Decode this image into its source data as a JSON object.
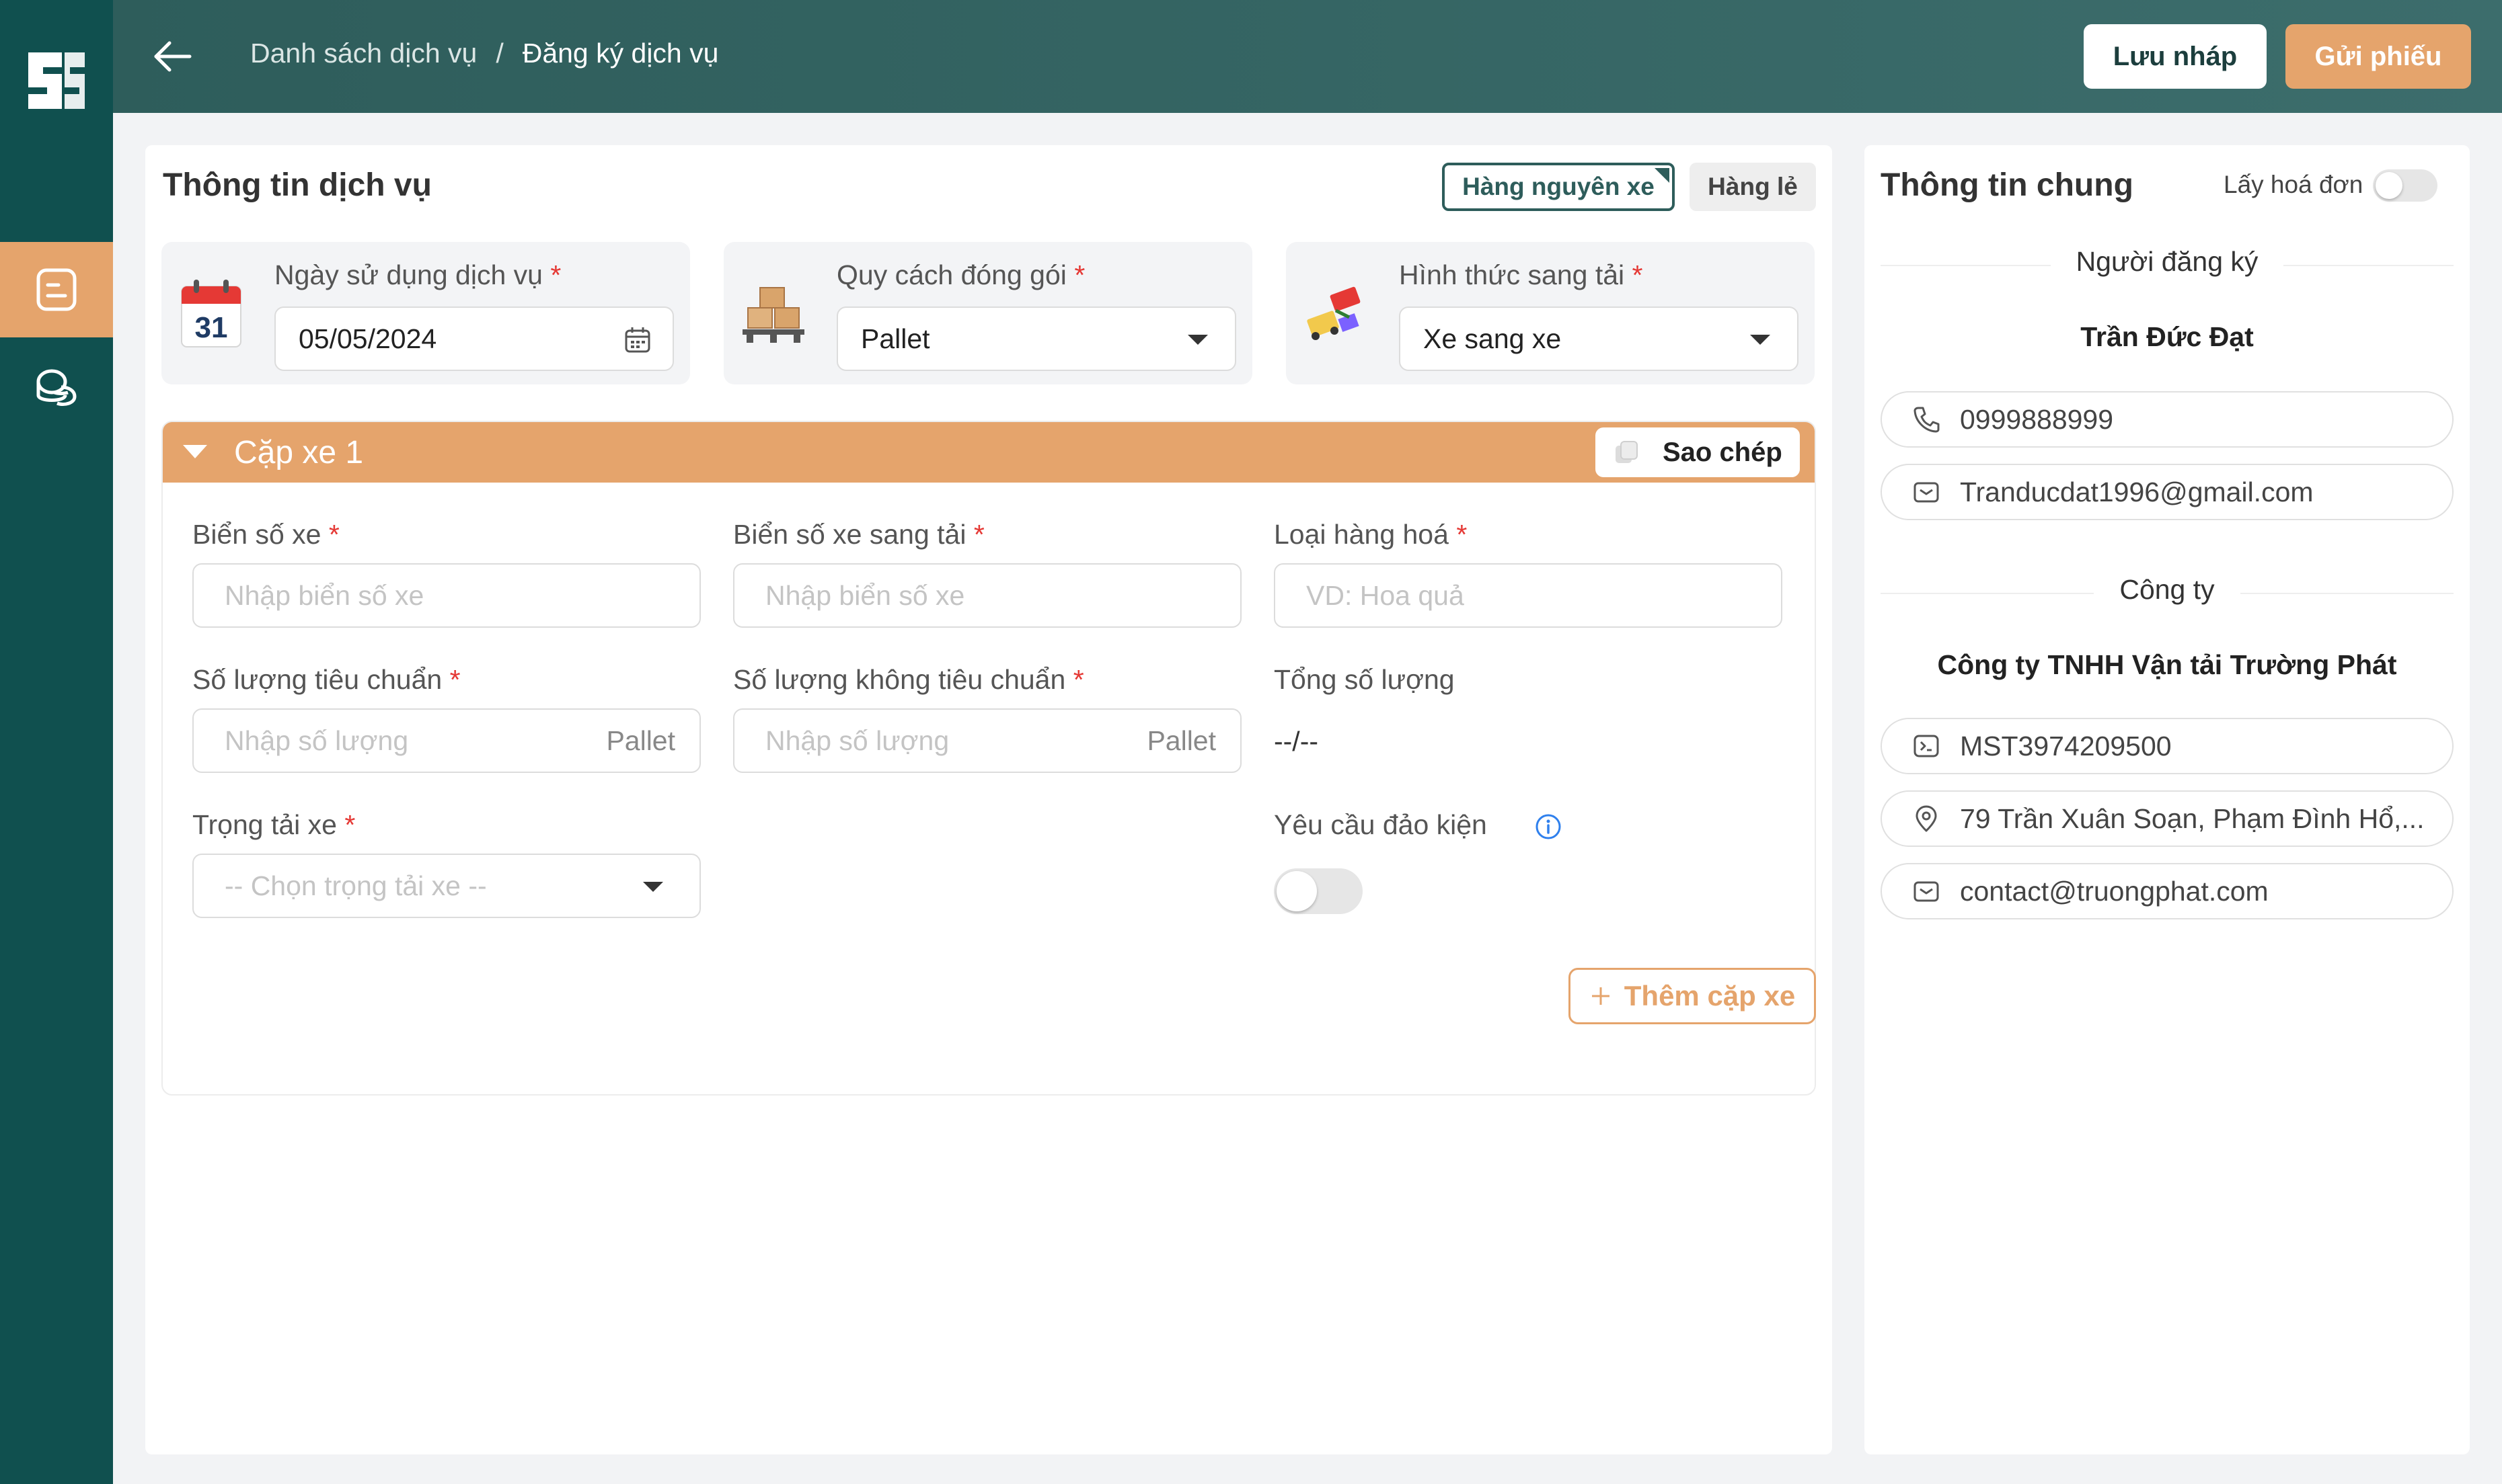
{
  "header": {
    "breadcrumb_parent": "Danh sách dịch vụ",
    "breadcrumb_separator": "/",
    "breadcrumb_current": "Đăng ký dịch vụ",
    "save_draft_label": "Lưu nháp",
    "submit_label": "Gửi phiếu"
  },
  "service": {
    "title": "Thông tin dịch vụ",
    "type_active": "Hàng nguyên xe",
    "type_inactive": "Hàng lẻ",
    "date_label": "Ngày sử dụng dịch vụ",
    "date_value": "05/05/2024",
    "date_icon_day": "31",
    "packing_label": "Quy cách đóng gói",
    "packing_value": "Pallet",
    "transfer_label": "Hình thức sang tải",
    "transfer_value": "Xe sang xe",
    "required_mark": "*"
  },
  "pair": {
    "title": "Cặp xe 1",
    "copy_label": "Sao chép",
    "plate_label": "Biển số xe",
    "plate_placeholder": "Nhập biển số xe",
    "transfer_plate_label": "Biển số xe sang tải",
    "transfer_plate_placeholder": "Nhập biển số xe",
    "goods_label": "Loại hàng hoá",
    "goods_placeholder": "VD: Hoa quả",
    "std_qty_label": "Số lượng tiêu chuẩn",
    "std_qty_placeholder": "Nhập số lượng",
    "std_qty_unit": "Pallet",
    "nonstd_qty_label": "Số lượng không tiêu chuẩn",
    "nonstd_qty_placeholder": "Nhập số lượng",
    "nonstd_qty_unit": "Pallet",
    "total_label": "Tổng số lượng",
    "total_value": "--/--",
    "load_label": "Trọng tải xe",
    "load_placeholder": "-- Chọn trọng tải xe --",
    "rearrange_label": "Yêu cầu đảo kiện",
    "rearrange_on": false
  },
  "add_pair_label": "Thêm cặp xe",
  "general": {
    "title": "Thông tin chung",
    "invoice_label": "Lấy hoá đơn",
    "invoice_on": false,
    "registrant_section": "Người đăng ký",
    "registrant_name": "Trần Đức Đạt",
    "phone": "0999888999",
    "email": "Tranducdat1996@gmail.com",
    "company_section": "Công ty",
    "company_name": "Công ty TNHH Vận tải Trường Phát",
    "tax_code": "MST3974209500",
    "address": "79 Trần Xuân Soạn, Phạm Đình Hổ,...",
    "company_email": "contact@truongphat.com"
  },
  "colors": {
    "sidebar": "#10504f",
    "header": "#3c6d6c",
    "accent": "#e5a46c",
    "required": "#e53935"
  },
  "icons": [
    "app-logo",
    "back-arrow-icon",
    "document-icon",
    "coins-icon",
    "calendar-icon",
    "pallet-icon",
    "truck-transfer-icon",
    "copy-icon",
    "info-icon",
    "plus-icon",
    "phone-icon",
    "mail-icon",
    "terminal-icon",
    "location-pin-icon"
  ]
}
